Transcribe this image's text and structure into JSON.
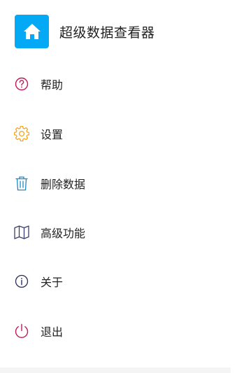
{
  "header": {
    "icon": "home-icon",
    "icon_bg": "#03A9F4",
    "title": "超级数据查看器"
  },
  "menu": [
    {
      "label": "帮助",
      "icon": "help-circle-icon",
      "color": "#C2185B"
    },
    {
      "label": "设置",
      "icon": "gear-icon",
      "color": "#F5A623"
    },
    {
      "label": "删除数据",
      "icon": "trash-icon",
      "color": "#1E88C8"
    },
    {
      "label": "高级功能",
      "icon": "map-icon",
      "color": "#3A3F6B"
    },
    {
      "label": "关于",
      "icon": "info-circle-icon",
      "color": "#2B2F5C"
    },
    {
      "label": "退出",
      "icon": "power-icon",
      "color": "#C2185B"
    }
  ]
}
